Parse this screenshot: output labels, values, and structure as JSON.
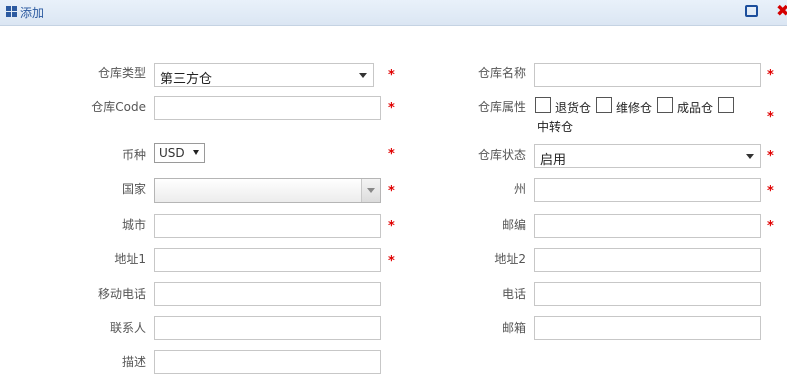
{
  "dialog": {
    "title": "添加"
  },
  "form": {
    "warehouse_type": {
      "label": "仓库类型",
      "value": "第三方仓"
    },
    "warehouse_name": {
      "label": "仓库名称",
      "value": ""
    },
    "warehouse_code": {
      "label": "仓库Code",
      "value": ""
    },
    "warehouse_attr": {
      "label": "仓库属性",
      "options": [
        "退货仓",
        "维修仓",
        "成品仓",
        "中转仓"
      ]
    },
    "currency": {
      "label": "币种",
      "value": "USD"
    },
    "warehouse_status": {
      "label": "仓库状态",
      "value": "启用"
    },
    "country": {
      "label": "国家",
      "value": ""
    },
    "state": {
      "label": "州",
      "value": ""
    },
    "city": {
      "label": "城市",
      "value": ""
    },
    "postcode": {
      "label": "邮编",
      "value": ""
    },
    "address1": {
      "label": "地址1",
      "value": ""
    },
    "address2": {
      "label": "地址2",
      "value": ""
    },
    "mobile": {
      "label": "移动电话",
      "value": ""
    },
    "phone": {
      "label": "电话",
      "value": ""
    },
    "contact": {
      "label": "联系人",
      "value": ""
    },
    "email": {
      "label": "邮箱",
      "value": ""
    },
    "description": {
      "label": "描述",
      "value": ""
    }
  },
  "required_mark": "*",
  "colors": {
    "required": "#e00000",
    "title": "#2c5aa0",
    "close": "#d40000"
  }
}
